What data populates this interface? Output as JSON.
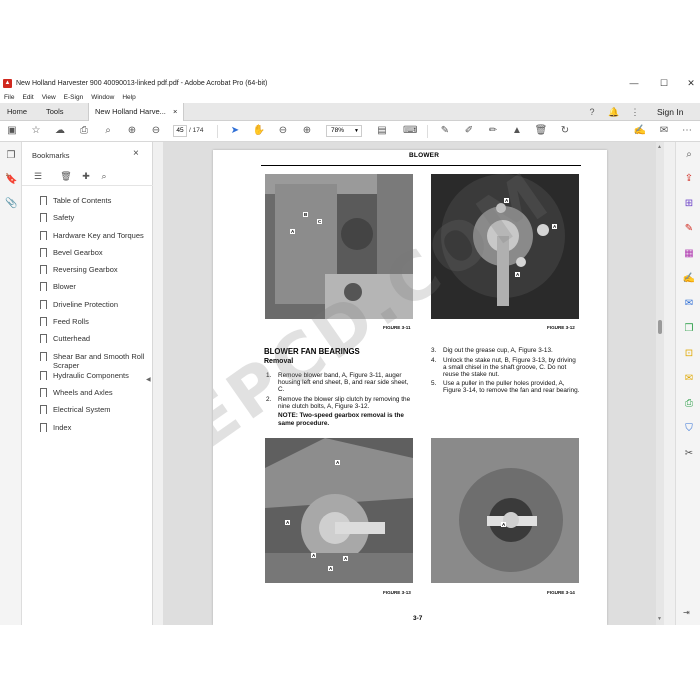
{
  "window": {
    "title": "New Holland Harvester 900 40090013-linked pdf.pdf - Adobe Acrobat Pro (64-bit)",
    "minimize": "—",
    "maximize": "☐",
    "close": "✕"
  },
  "menu": [
    "File",
    "Edit",
    "View",
    "E-Sign",
    "Window",
    "Help"
  ],
  "tabs": {
    "home": "Home",
    "tools": "Tools",
    "document": "New Holland Harve...",
    "document_close": "×",
    "sign_in": "Sign In"
  },
  "toolbar": {
    "current_page": "45",
    "total_pages": "/ 174",
    "zoom": "78%"
  },
  "bookmarks": {
    "title": "Bookmarks",
    "close": "×",
    "items": [
      "Table of Contents",
      "Safety",
      "Hardware Key and Torques",
      "Bevel Gearbox",
      "Reversing Gearbox",
      "Blower",
      "Driveline Protection",
      "Feed Rolls",
      "Cutterhead",
      "Shear Bar and Smooth Roll Scraper",
      "Hydraulic Components",
      "Wheels and Axles",
      "Electrical System",
      "Index"
    ]
  },
  "page": {
    "header": "BLOWER",
    "captions": [
      "FIGURE 3-11",
      "FIGURE 3-12",
      "FIGURE 3-13",
      "FIGURE 3-14"
    ],
    "section_heading": "BLOWER FAN BEARINGS",
    "subheading": "Removal",
    "steps_left": [
      {
        "n": "1.",
        "text": "Remove blower band, A, Figure 3-11, auger housing left end sheet, B, and rear side sheet, C."
      },
      {
        "n": "2.",
        "text": "Remove the blower slip clutch by removing the nine clutch bolts, A, Figure 3-12."
      }
    ],
    "note": "NOTE: Two-speed gearbox removal is the same procedure.",
    "steps_right": [
      {
        "n": "3.",
        "text": "Dig out the grease cup, A, Figure 3-13."
      },
      {
        "n": "4.",
        "text": "Unlock the stake nut, B, Figure 3-13, by driving a small chisel in the shaft groove, C. Do not reuse the stake nut."
      },
      {
        "n": "5.",
        "text": "Use a puller in the puller holes provided, A, Figure 3-14, to remove the fan and rear bearing."
      }
    ],
    "page_number": "3-7",
    "watermark": "EPCD.COM",
    "photo_labels": {
      "fig11": [
        "A",
        "B",
        "C"
      ],
      "fig12": [
        "A",
        "A",
        "A"
      ],
      "fig13": [
        "A",
        "A",
        "A",
        "A",
        "A"
      ],
      "fig14": [
        "A"
      ]
    }
  }
}
